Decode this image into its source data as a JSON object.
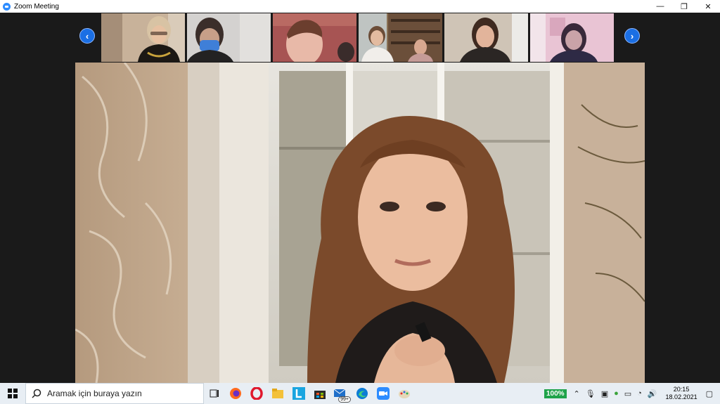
{
  "window": {
    "title": "Zoom Meeting",
    "minimize_glyph": "—",
    "restore_glyph": "❐",
    "close_glyph": "✕"
  },
  "gallery": {
    "prev_glyph": "‹",
    "next_glyph": "›",
    "participants": [
      {
        "id": "p1",
        "scene": "elder-woman-glasses"
      },
      {
        "id": "p2",
        "scene": "blue-mask-person"
      },
      {
        "id": "p3",
        "scene": "child-closeup"
      },
      {
        "id": "p4",
        "scene": "two-people-bookshelf"
      },
      {
        "id": "p5",
        "scene": "dark-hair-woman"
      },
      {
        "id": "p6",
        "scene": "person-pink-wall"
      }
    ]
  },
  "taskbar": {
    "search_placeholder": "Aramak için buraya yazın",
    "mail_badge": "99+",
    "battery": "100%",
    "time": "20:15",
    "date": "18.02.2021"
  },
  "colors": {
    "zoom_blue": "#2d8cff",
    "arrow_blue": "#1b6fe4",
    "battery_green": "#1fa34a"
  }
}
